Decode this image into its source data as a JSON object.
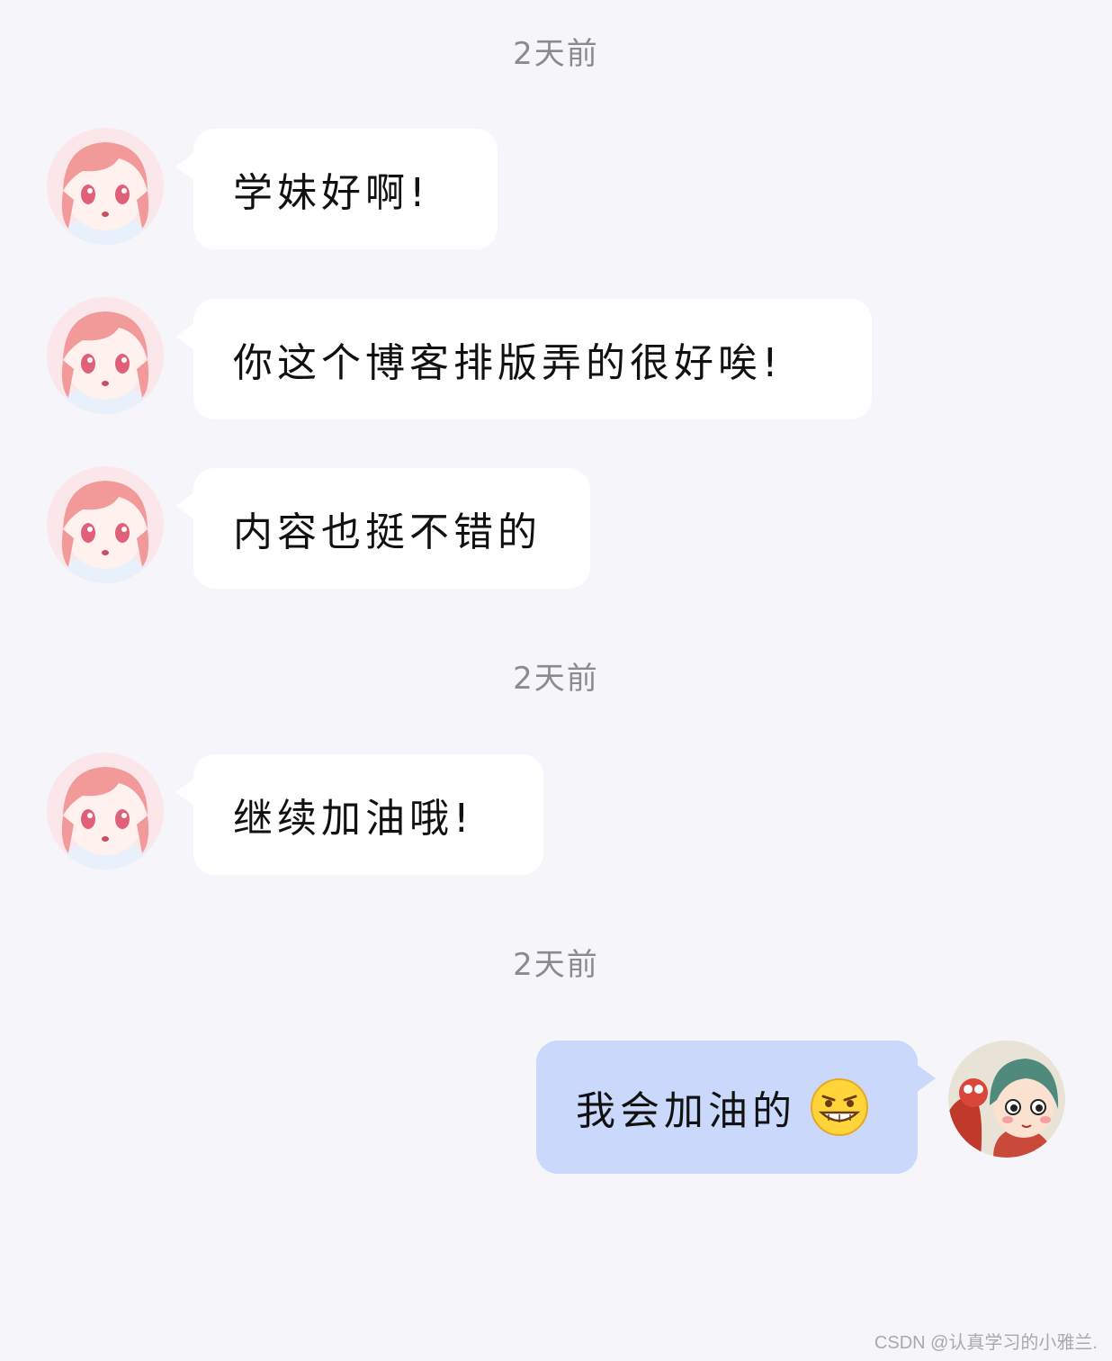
{
  "timestamps": [
    "2天前",
    "2天前",
    "2天前"
  ],
  "messages": [
    {
      "sender": "other",
      "text": "学妹好啊!"
    },
    {
      "sender": "other",
      "text": "你这个博客排版弄的很好唉!"
    },
    {
      "sender": "other",
      "text": "内容也挺不错的"
    },
    {
      "sender": "other",
      "text": "继续加油哦!"
    },
    {
      "sender": "me",
      "text": "我会加油的",
      "emoji": "grinning-face-icon"
    }
  ],
  "watermark": "CSDN @认真学习的小雅兰.",
  "colors": {
    "background": "#f6f6fa",
    "incoming_bubble": "#ffffff",
    "outgoing_bubble": "#c9d8fb",
    "timestamp": "#8a8a8f"
  }
}
